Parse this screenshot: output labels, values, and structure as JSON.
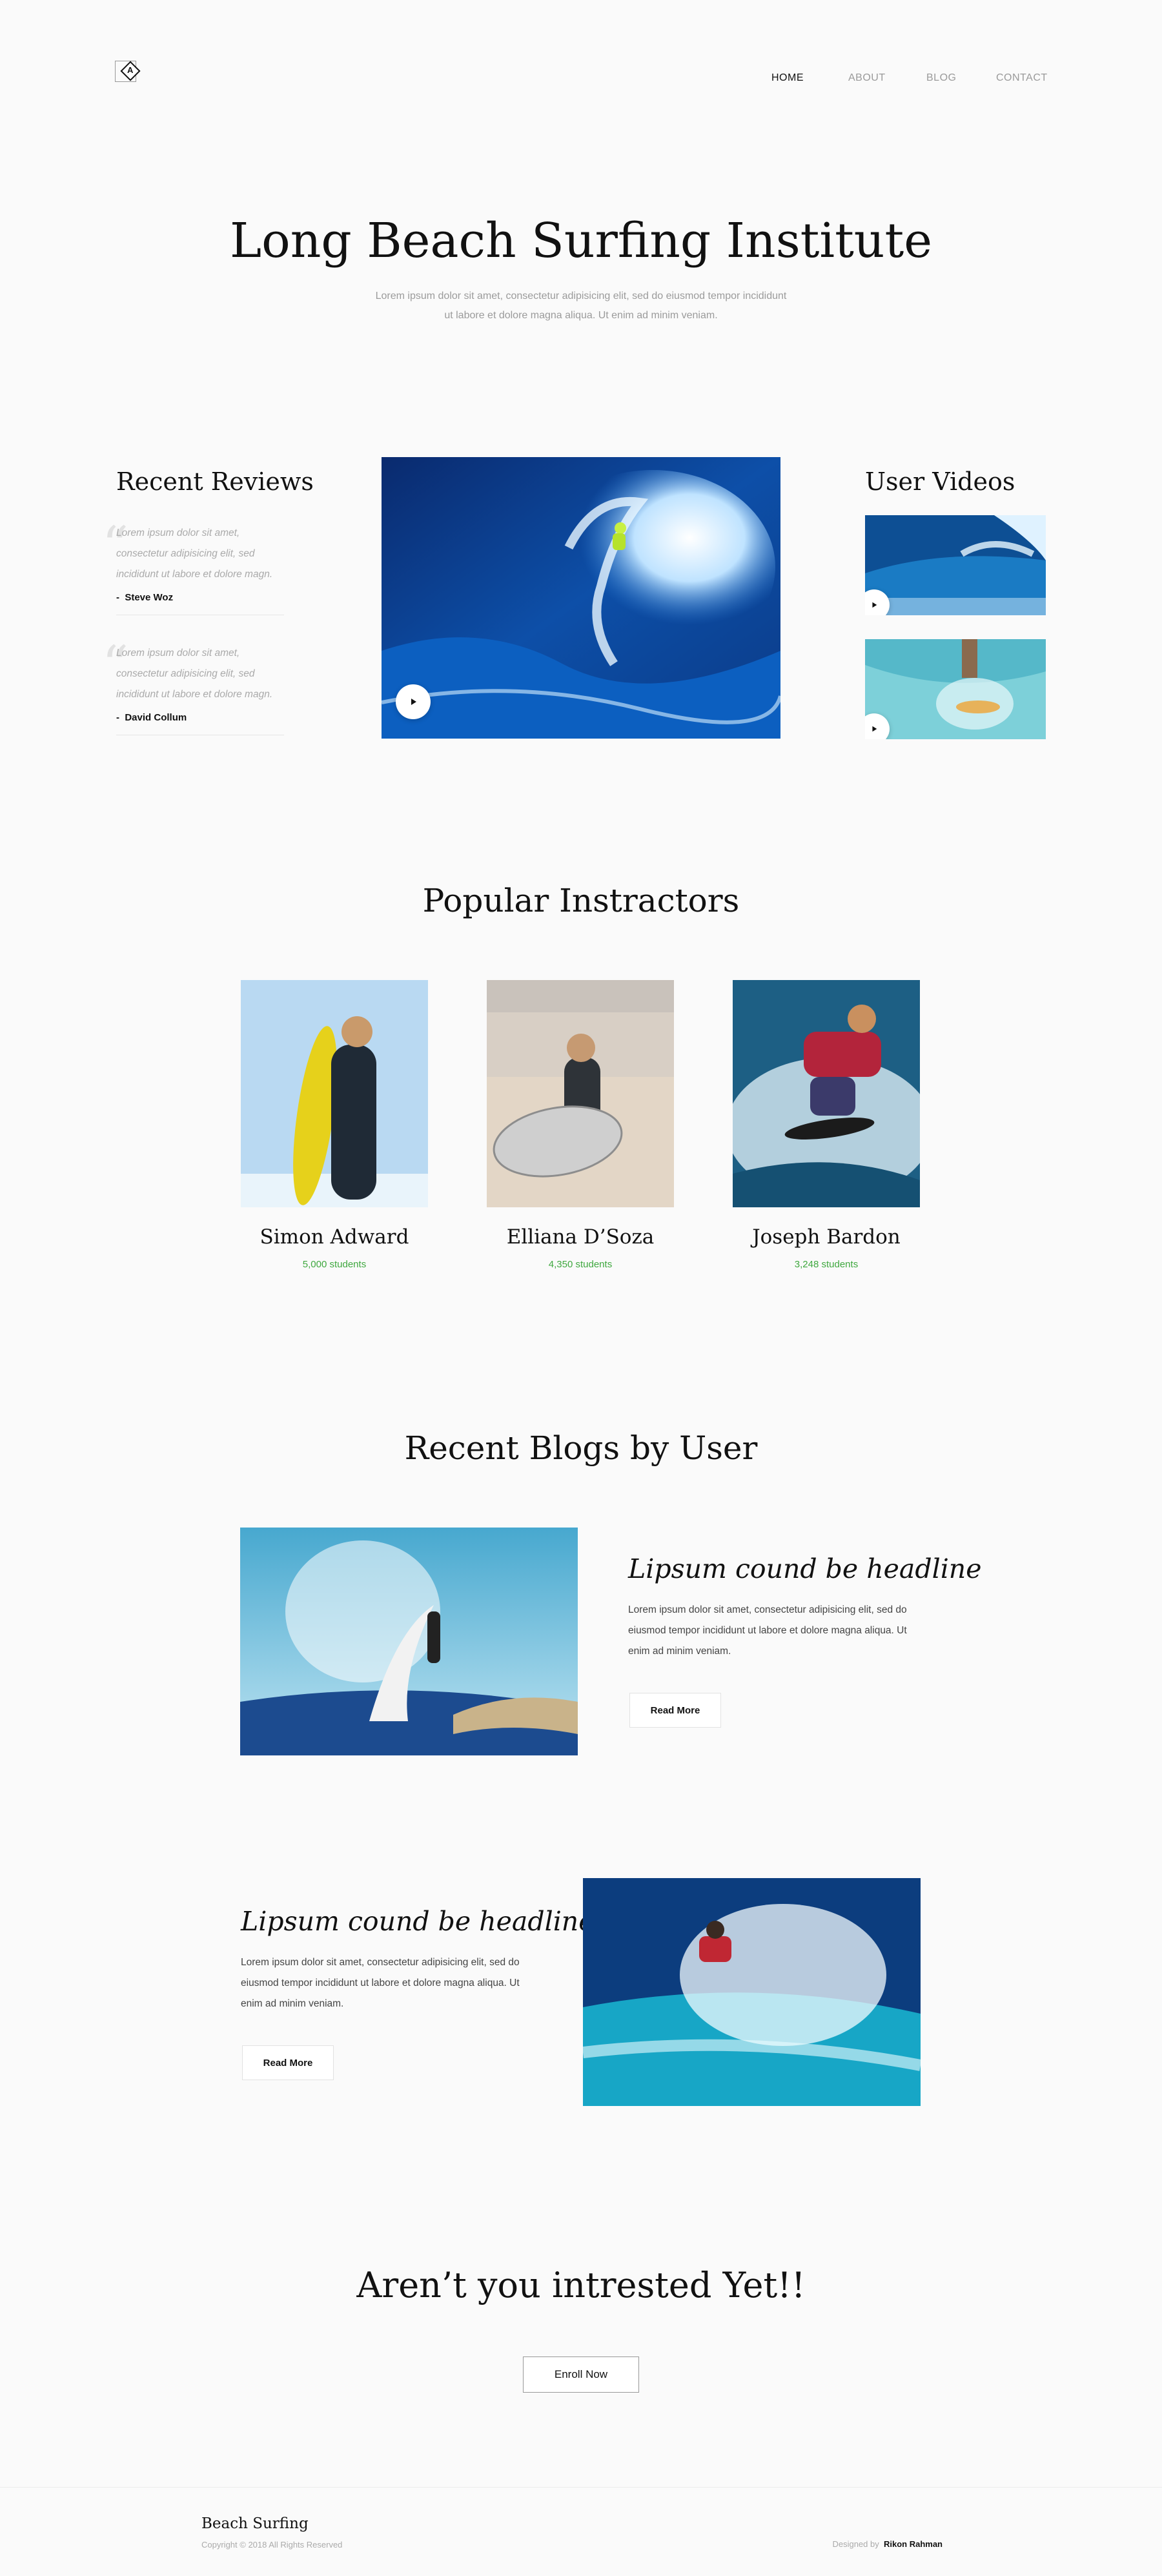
{
  "header": {
    "logo_letter": "A",
    "nav": [
      {
        "label": "HOME",
        "active": true
      },
      {
        "label": "ABOUT",
        "active": false
      },
      {
        "label": "BLOG",
        "active": false
      },
      {
        "label": "CONTACT",
        "active": false
      }
    ]
  },
  "hero": {
    "title": "Long Beach Surfing Institute",
    "subtitle": "Lorem ipsum dolor sit amet, consectetur adipisicing elit, sed do eiusmod tempor incididunt ut labore et dolore magna aliqua. Ut enim ad minim veniam."
  },
  "reviews": {
    "heading": "Recent Reviews",
    "items": [
      {
        "text": "Lorem ipsum dolor sit amet, consectetur adipisicing elit, sed incididunt ut labore et dolore magn.",
        "author": "Steve Woz"
      },
      {
        "text": "Lorem ipsum dolor sit amet, consectetur adipisicing elit, sed incididunt ut labore et dolore magn.",
        "author": "David Collum"
      }
    ],
    "author_prefix": "-"
  },
  "videos": {
    "heading": "User Videos"
  },
  "instructors": {
    "heading": "Popular Instractors",
    "items": [
      {
        "name": "Simon Adward",
        "students": "5,000 students"
      },
      {
        "name": "Elliana D’Soza",
        "students": "4,350 students"
      },
      {
        "name": "Joseph Bardon",
        "students": "3,248 students"
      }
    ]
  },
  "blogs": {
    "heading": "Recent Blogs by User",
    "items": [
      {
        "headline": "Lipsum cound be headline",
        "text": "Lorem ipsum dolor sit amet, consectetur adipisicing elit, sed do eiusmod tempor incididunt ut labore et dolore magna aliqua. Ut enim ad minim veniam.",
        "button": "Read More"
      },
      {
        "headline": "Lipsum cound be headline",
        "text": "Lorem ipsum dolor sit amet, consectetur adipisicing elit, sed do eiusmod tempor incididunt ut labore et dolore magna aliqua. Ut enim ad minim veniam.",
        "button": "Read More"
      }
    ]
  },
  "cta": {
    "heading": "Aren’t you intrested Yet!!",
    "button": "Enroll Now"
  },
  "footer": {
    "brand": "Beach Surfing",
    "copyright": "Copyright © 2018 All Rights Reserved",
    "designed_by_label": "Designed by",
    "designer": "Rikon Rahman"
  },
  "colors": {
    "accent_green": "#3fa83f",
    "background": "#fafafa"
  }
}
